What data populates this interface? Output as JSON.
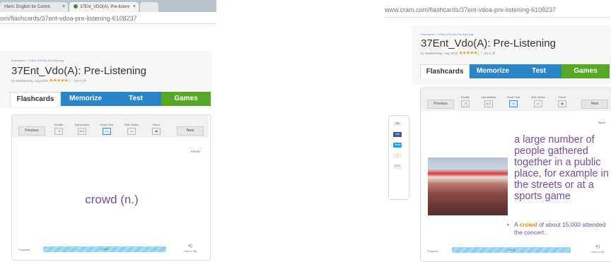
{
  "left": {
    "tabs": [
      {
        "label": "nfern: English for Comm",
        "active": false
      },
      {
        "label": "37Ent_VDO(A): Pre-listeni",
        "active": true
      }
    ],
    "url": "om/flashcards/37ent-vdoa-pre-listening-6108237",
    "breadcrumb": "Flashcards > 37Ent_VDO(A) Pre-listening",
    "title": "37Ent_Vdo(A): Pre-Listening",
    "byline": "by swelistening, Aug 2015",
    "meta_extra": "| ♡ | ⊟ 0 | ⁋",
    "mode_tabs": [
      "Flashcards",
      "Memorize",
      "Test",
      "Games"
    ],
    "toolbar": {
      "previous": "Previous",
      "next": "Next",
      "tools": [
        "Shuffle",
        "Alphabetize",
        "Front First",
        "Both Sides",
        "Read"
      ],
      "tool_icons": [
        "shuffle-icon",
        "alphabetize-icon",
        "front-first-icon",
        "both-sides-icon",
        "read-aloud-icon"
      ]
    },
    "side_label": "FRONT",
    "term": "crowd (n.)",
    "progress_label": "Progress",
    "progress_text": "1 of 5",
    "progress_fraction": 1.0,
    "flip_label": "Click to flip"
  },
  "right": {
    "url": "www.cram.com/flashcards/37ent-vdoa-pre-listening-6108237",
    "breadcrumb": "Flashcards > 37Ent_VDO(A) Pre-listening",
    "title": "37Ent_Vdo(A): Pre-Listening",
    "byline": "by swelistening, Aug 2015",
    "meta_extra": "| ♡ | ⊟ 0 | ⁋",
    "mode_tabs": [
      "Flashcards",
      "Memorize",
      "Test",
      "Games"
    ],
    "toolbar": {
      "previous": "Previous",
      "next": "Next",
      "tools": [
        "Shuffle",
        "Alphabetize",
        "Front First",
        "Both Sides",
        "Read"
      ]
    },
    "social": [
      "10k",
      "Like",
      "Tweet",
      "",
      "G+1"
    ],
    "side_label": "BACK",
    "definition": "a large number of people gathered together in a public place, for example in the streets or at a sports game",
    "example_before": "A ",
    "example_highlight": "crowd",
    "example_after": " of about 15,000 attended the concert.",
    "progress_label": "Progress",
    "progress_text": "1 of 5",
    "progress_fraction": 1.0,
    "flip_label": "Click to flip"
  },
  "colors": {
    "memorize": "#2b84c6",
    "test": "#2b84c6",
    "games": "#58a825",
    "term": "#7a4c99",
    "highlight": "#e48d1a"
  }
}
